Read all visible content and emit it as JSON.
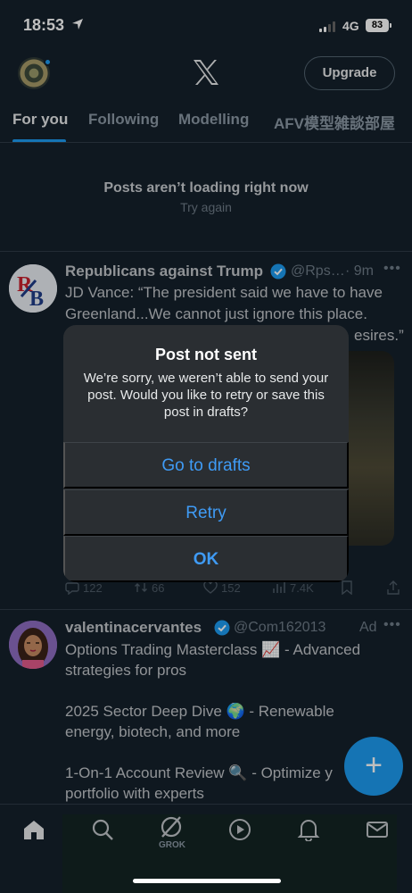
{
  "status_bar": {
    "time": "18:53",
    "network": "4G",
    "battery": "83"
  },
  "header": {
    "upgrade_label": "Upgrade"
  },
  "tabs": [
    {
      "label": "For you",
      "active": true
    },
    {
      "label": "Following",
      "active": false
    },
    {
      "label": "Modelling",
      "active": false
    },
    {
      "label": "AFV模型雑談部屋",
      "active": false
    }
  ],
  "feed_error": {
    "title": "Posts aren’t loading right now",
    "retry": "Try again"
  },
  "post1": {
    "author": "Republicans against Trump",
    "handle": "@Rps…",
    "time": "· 9m",
    "line1": "JD Vance: “The president said we have to have",
    "line2": "Greenland...We cannot just ignore this place.",
    "line3_tail": "esires.”",
    "replies": "122",
    "reposts": "66",
    "likes": "152",
    "views": "7.4K"
  },
  "post2": {
    "author": "valentinacervantes",
    "handle": "@Com162013",
    "ad": "Ad",
    "line1": "Options Trading Masterclass 📈 - Advanced",
    "line2": "strategies for pros",
    "line3": "2025 Sector Deep Dive 🌍 - Renewable",
    "line4": "energy, biotech, and more",
    "line5": "1-On-1 Account Review 🔍 - Optimize y",
    "line6": "portfolio with experts"
  },
  "alert": {
    "title": "Post not sent",
    "message": "We’re sorry, we weren’t able to send your post. Would you like to retry or save this post in drafts?",
    "buttons": {
      "drafts": "Go to drafts",
      "retry": "Retry",
      "ok": "OK"
    }
  },
  "nav": {
    "grok_label": "GROK"
  },
  "colors": {
    "accent": "#1d9bf0",
    "background": "#15202b",
    "alert_button": "#3f9bf5"
  }
}
